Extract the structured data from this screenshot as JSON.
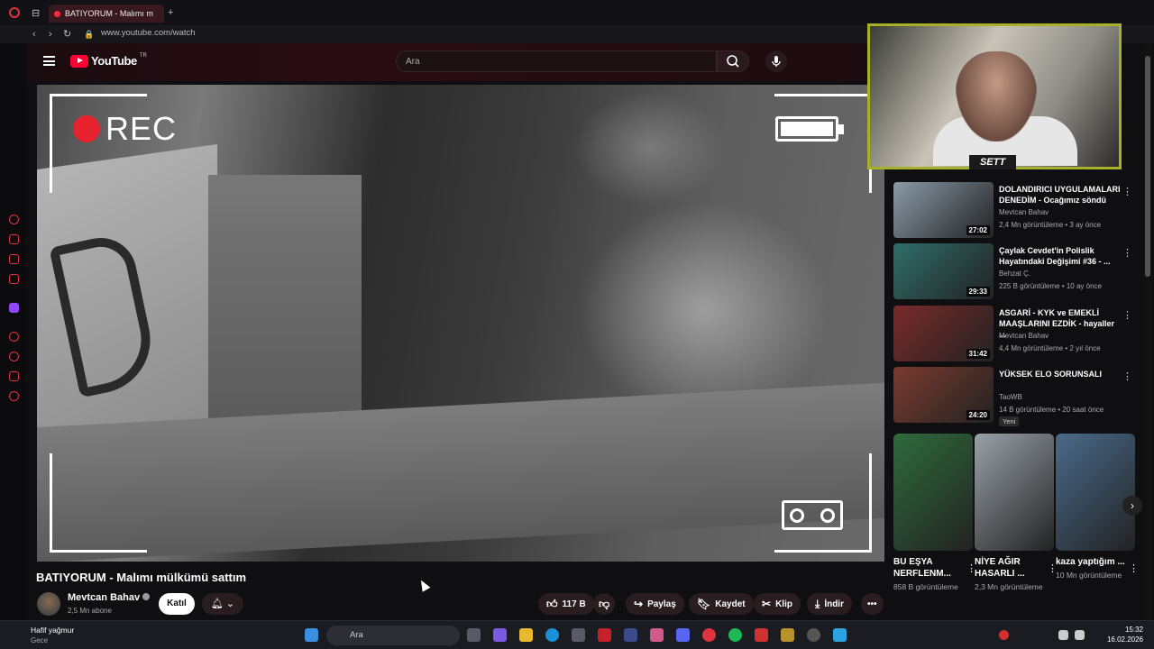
{
  "browser": {
    "tab_title": "BATIYORUM - Malımı m",
    "url": "www.youtube.com/watch"
  },
  "header": {
    "logo_text": "YouTube",
    "region": "TR",
    "search_placeholder": "Ara"
  },
  "video": {
    "overlay_rec": "REC",
    "title": "BATIYORUM - Malımı mülkümü sattım",
    "channel": "Mevtcan Bahav",
    "subscribers": "2,5 Mn abone",
    "join_label": "Katıl",
    "actions": {
      "likes": "117 B",
      "share": "Paylaş",
      "save": "Kaydet",
      "clip": "Klip",
      "download": "İndir"
    }
  },
  "webcam": {
    "name": "SETT"
  },
  "recommendations": [
    {
      "title": "DOLANDIRICI UYGULAMALARI DENEDİM - Ocağımız söndü",
      "channel": "Mevtcan Bahav",
      "meta": "2,4 Mn görüntüleme • 3 ay önce",
      "duration": "27:02",
      "color": "#8a9aa8"
    },
    {
      "title": "Çaylak Cevdet'in Polislik Hayatındaki Değişimi #36 - ...",
      "channel": "Behzat Ç.",
      "meta": "225 B görüntüleme • 10 ay önce",
      "duration": "29:33",
      "color": "#2f6e6a"
    },
    {
      "title": "ASGARİ - KYK ve EMEKLİ MAAŞLARINI EZDİK - hayaller ...",
      "channel": "Mevtcan Bahav",
      "meta": "4,4 Mn görüntüleme • 2 yıl önce",
      "duration": "31:42",
      "color": "#7a2a2a"
    },
    {
      "title": "YÜKSEK ELO SORUNSALI",
      "channel": "TaoWB",
      "meta": "14 B görüntüleme • 20 saat önce",
      "duration": "24:20",
      "badge": "Yeni",
      "color": "#7a3a2f"
    }
  ],
  "shorts": [
    {
      "title": "BU EŞYA NERFLENM...",
      "views": "858 B görüntüleme",
      "color": "#2e6b3c"
    },
    {
      "title": "NİYE AĞIR HASARLI ...",
      "views": "2,3 Mn görüntüleme",
      "color": "#9aa1a8"
    },
    {
      "title": "kaza yaptığım ...",
      "views": "10 Mn görüntüleme",
      "color": "#4a6a8a"
    }
  ],
  "taskbar": {
    "weather": "Hafif yağmur",
    "weather_sub": "Gece",
    "search_placeholder": "Ara",
    "time": "15:32",
    "date": "16.02.2026"
  }
}
